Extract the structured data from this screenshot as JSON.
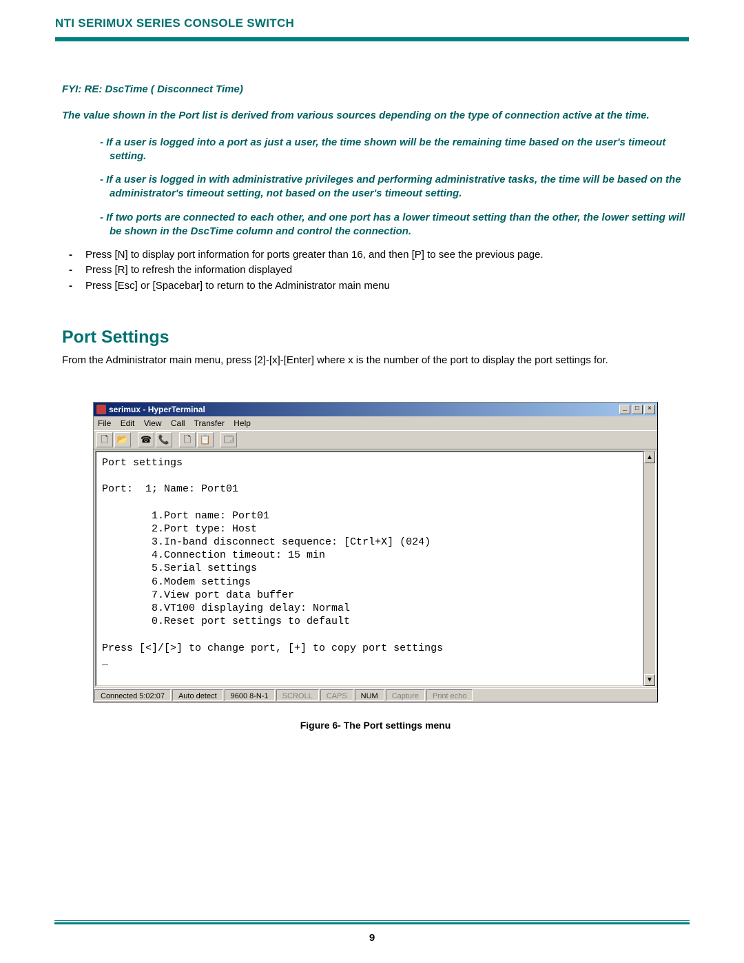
{
  "header": {
    "title": "NTI SERIMUX SERIES CONSOLE SWITCH"
  },
  "fyi": {
    "title": "FYI: RE: DscTime ( Disconnect Time)",
    "intro": "The value shown in the Port list is derived from various sources depending on the type of connection active at the time.",
    "items": [
      "- If a user is logged into a port as just a user,  the time shown will be the remaining time based on the user's timeout setting.",
      "- If a user is logged in with administrative privileges and performing administrative tasks,  the time will be based on the  administrator's timeout setting,  not based on the user's timeout setting.",
      "- If two ports are connected to each other,  and one port has a lower timeout setting than the other,   the lower setting will be shown in the DscTime column and control the connection."
    ]
  },
  "instructions": [
    "Press [N] to display port information for ports greater than 16, and then [P] to see the previous page.",
    "Press [R] to refresh the information displayed",
    "Press [Esc] or [Spacebar] to return to the Administrator main menu"
  ],
  "section": {
    "title": "Port Settings",
    "para": "From the Administrator main menu, press [2]-[x]-[Enter] where x is the number of the port to display the port settings for."
  },
  "ht": {
    "window_title": "serimux - HyperTerminal",
    "menus": [
      "File",
      "Edit",
      "View",
      "Call",
      "Transfer",
      "Help"
    ],
    "win_buttons": {
      "min": "_",
      "max": "□",
      "close": "×"
    },
    "toolbar_icons": [
      "🗋",
      "📂",
      "☎",
      "📞",
      "🗋",
      "📋",
      "🗔"
    ],
    "terminal_text": "Port settings\n\nPort:  1; Name: Port01\n\n        1.Port name: Port01\n        2.Port type: Host\n        3.In-band disconnect sequence: [Ctrl+X] (024)\n        4.Connection timeout: 15 min\n        5.Serial settings\n        6.Modem settings\n        7.View port data buffer\n        8.VT100 displaying delay: Normal\n        0.Reset port settings to default\n\nPress [<]/[>] to change port, [+] to copy port settings\n_",
    "status": {
      "connected": "Connected 5:02:07",
      "detect": "Auto detect",
      "baud": "9600 8-N-1",
      "scroll": "SCROLL",
      "caps": "CAPS",
      "num": "NUM",
      "capture": "Capture",
      "printecho": "Print echo"
    },
    "scroll_arrows": {
      "up": "▲",
      "down": "▼"
    }
  },
  "figure_caption": "Figure 6- The Port settings menu",
  "page_number": "9"
}
